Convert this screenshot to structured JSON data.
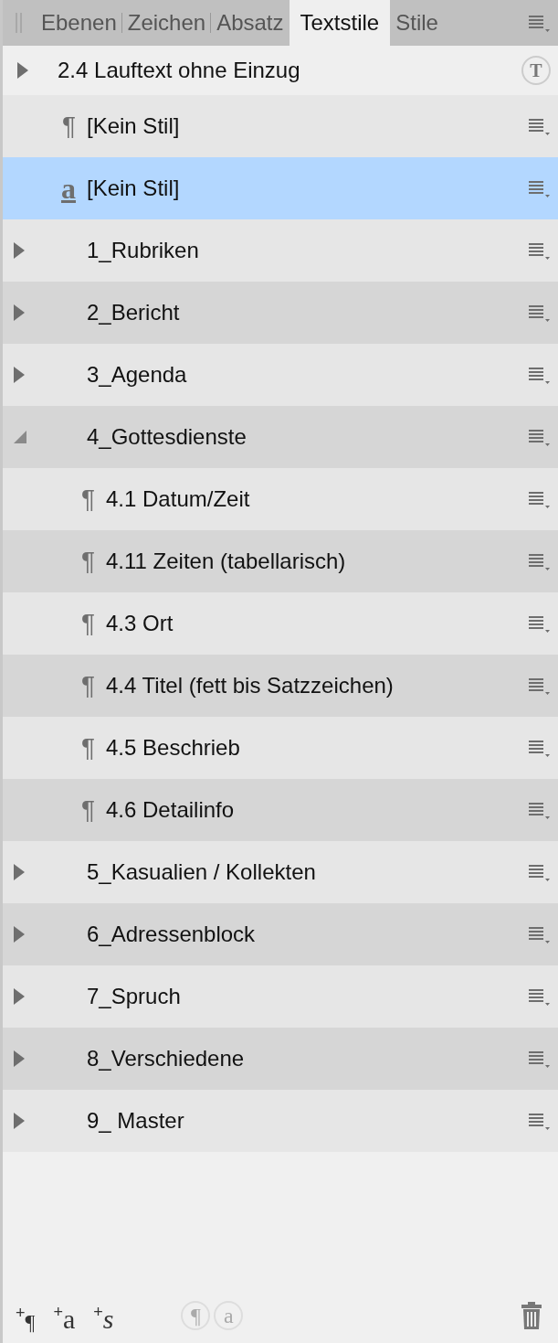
{
  "tabs": [
    {
      "label": "Ebenen",
      "selected": false
    },
    {
      "label": "Zeichen",
      "selected": false
    },
    {
      "label": "Absatz",
      "selected": false
    },
    {
      "label": "Textstile",
      "selected": true
    },
    {
      "label": "Stile",
      "selected": false
    }
  ],
  "current_style": {
    "name": "2.4 Lauftext ohne Einzug",
    "icon": "T"
  },
  "styles": [
    {
      "kind": "paragraph",
      "icon": "¶",
      "name": "[Kein Stil]",
      "selected": false
    },
    {
      "kind": "character",
      "icon": "a",
      "name": "[Kein Stil]",
      "selected": true
    },
    {
      "kind": "group",
      "name": "1_Rubriken",
      "expanded": false,
      "selected": false
    },
    {
      "kind": "group",
      "name": "2_Bericht",
      "expanded": false,
      "selected": false
    },
    {
      "kind": "group",
      "name": "3_Agenda",
      "expanded": false,
      "selected": false
    },
    {
      "kind": "group",
      "name": "4_Gottesdienste",
      "expanded": true,
      "selected": false,
      "children": [
        {
          "kind": "paragraph",
          "icon": "¶",
          "name": "4.1 Datum/Zeit",
          "selected": false
        },
        {
          "kind": "paragraph",
          "icon": "¶",
          "name": "4.11 Zeiten (tabellarisch)",
          "selected": false
        },
        {
          "kind": "paragraph",
          "icon": "¶",
          "name": "4.3 Ort",
          "selected": false
        },
        {
          "kind": "paragraph",
          "icon": "¶",
          "name": "4.4 Titel (fett bis Satzzeichen)",
          "selected": false
        },
        {
          "kind": "paragraph",
          "icon": "¶",
          "name": "4.5 Beschrieb",
          "selected": false
        },
        {
          "kind": "paragraph",
          "icon": "¶",
          "name": "4.6 Detailinfo",
          "selected": false
        }
      ]
    },
    {
      "kind": "group",
      "name": "5_Kasualien / Kollekten",
      "expanded": false,
      "selected": false
    },
    {
      "kind": "group",
      "name": "6_Adressenblock",
      "expanded": false,
      "selected": false
    },
    {
      "kind": "group",
      "name": "7_Spruch",
      "expanded": false,
      "selected": false
    },
    {
      "kind": "group",
      "name": "8_Verschiedene",
      "expanded": false,
      "selected": false
    },
    {
      "kind": "group",
      "name": "9_ Master",
      "expanded": false,
      "selected": false
    }
  ],
  "toolbar": [
    {
      "kind": "new-paragraph",
      "glyph": "$^{+}$¶",
      "disabled": false
    },
    {
      "kind": "new-character",
      "glyph": "$^{+}$a",
      "disabled": false
    },
    {
      "kind": "new-style",
      "glyph": "$^{+}$*s*",
      "disabled": false
    },
    {
      "kind": "apply-paragraph",
      "glyph": "¶",
      "disabled": true
    },
    {
      "kind": "apply-character",
      "glyph": "a",
      "disabled": true
    },
    {
      "kind": "delete",
      "disabled": false
    }
  ]
}
